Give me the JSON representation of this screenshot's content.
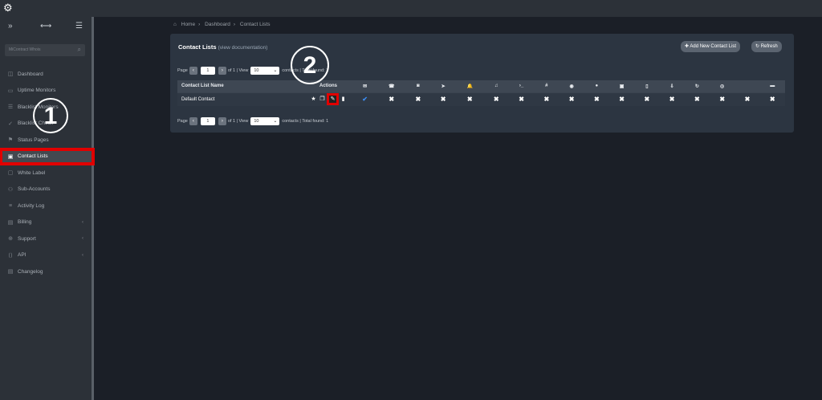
{
  "topbar": {
    "logo_icon": "gear-logo-icon"
  },
  "sidebar": {
    "search_placeholder": "MiContract Whois",
    "items": [
      {
        "label": "Dashboard",
        "icon": "dashboard-icon"
      },
      {
        "label": "Uptime Monitors",
        "icon": "monitor-icon"
      },
      {
        "label": "Blacklist Monitors",
        "icon": "list-icon"
      },
      {
        "label": "Blacklist Check",
        "icon": "check-icon"
      },
      {
        "label": "Status Pages",
        "icon": "status-icon"
      },
      {
        "label": "Contact Lists",
        "icon": "contact-icon",
        "active": true
      },
      {
        "label": "White Label",
        "icon": "label-icon"
      },
      {
        "label": "Sub-Accounts",
        "icon": "users-icon"
      },
      {
        "label": "Activity Log",
        "icon": "log-icon"
      },
      {
        "label": "Billing",
        "icon": "billing-icon",
        "chevron": true
      },
      {
        "label": "Support",
        "icon": "support-icon",
        "chevron": true
      },
      {
        "label": "API",
        "icon": "api-icon",
        "chevron": true
      },
      {
        "label": "Changelog",
        "icon": "changelog-icon"
      }
    ]
  },
  "breadcrumb": [
    "Home",
    "Dashboard",
    "Contact Lists"
  ],
  "panel": {
    "title": "Contact Lists",
    "doc_link": "(view documentation)",
    "add_button": "Add New Contact List",
    "refresh_button": "Refresh"
  },
  "pager": {
    "page_label": "Page",
    "page_value": "1",
    "of_label": "of 1 | View",
    "view_value": "10",
    "contacts_label": "contacts | Total found: 1"
  },
  "table": {
    "col_name": "Contact List Name",
    "col_actions": "Actions",
    "channel_icons": [
      "envelope",
      "phone",
      "whatsapp",
      "telegram",
      "bell",
      "bell-outline",
      "terminal",
      "slack",
      "discord",
      "chat",
      "teams",
      "mobile",
      "pushover",
      "refresh",
      "circle-arrow",
      "code",
      "bed"
    ],
    "rows": [
      {
        "name": "Default Contact",
        "channels": [
          "ok",
          "x",
          "x",
          "x",
          "x",
          "x",
          "x",
          "x",
          "x",
          "x",
          "x",
          "x",
          "x",
          "x",
          "x",
          "x",
          "x"
        ]
      }
    ]
  },
  "annotations": {
    "step1": "1",
    "step2": "2"
  },
  "colors": {
    "highlight": "#e10000",
    "accent": "#3b8cf0"
  }
}
